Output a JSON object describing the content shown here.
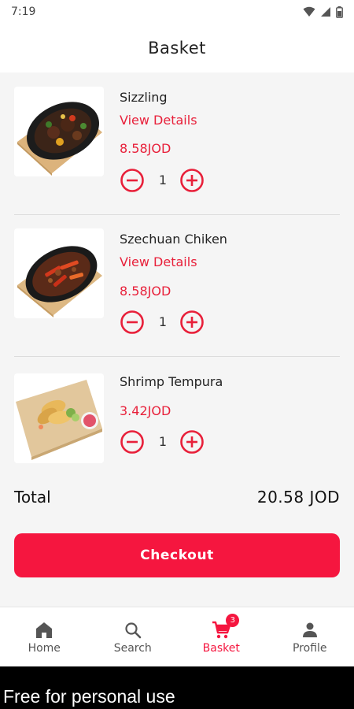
{
  "status_bar": {
    "time": "7:19"
  },
  "header": {
    "title": "Basket"
  },
  "items": [
    {
      "name": "Sizzling",
      "details_label": "View Details",
      "price": "8.58JOD",
      "quantity": "1"
    },
    {
      "name": "Szechuan Chiken",
      "details_label": "View Details",
      "price": "8.58JOD",
      "quantity": "1"
    },
    {
      "name": "Shrimp Tempura",
      "price": "3.42JOD",
      "quantity": "1"
    }
  ],
  "total": {
    "label": "Total",
    "value": "20.58 JOD"
  },
  "checkout": {
    "label": "Checkout"
  },
  "nav": {
    "items": [
      {
        "label": "Home",
        "icon": "home-icon"
      },
      {
        "label": "Search",
        "icon": "search-icon"
      },
      {
        "label": "Basket",
        "icon": "cart-icon",
        "badge": "3",
        "active": true
      },
      {
        "label": "Profile",
        "icon": "person-icon"
      }
    ]
  },
  "watermark": {
    "text": "Free for personal use"
  },
  "colors": {
    "accent": "#f5163f",
    "price_red": "#e8203a"
  }
}
